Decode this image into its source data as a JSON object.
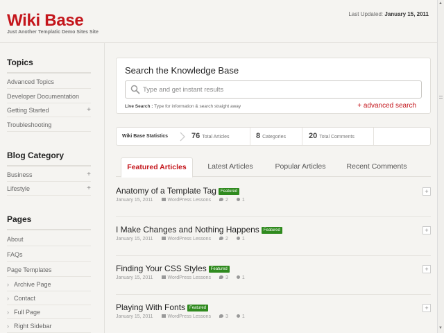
{
  "header": {
    "title": "Wiki Base",
    "tagline": "Just Another Templatic Demo Sites Site",
    "last_updated_label": "Last Updated:",
    "last_updated_date": "January 15, 2011"
  },
  "sidebar": {
    "sections": [
      {
        "heading": "Topics",
        "items": [
          {
            "label": "Advanced Topics",
            "expandable": false
          },
          {
            "label": "Developer Documentation",
            "expandable": false
          },
          {
            "label": "Getting Started",
            "expandable": true
          },
          {
            "label": "Troubleshooting",
            "expandable": false
          }
        ]
      },
      {
        "heading": "Blog Category",
        "items": [
          {
            "label": "Business",
            "expandable": true
          },
          {
            "label": "Lifestyle",
            "expandable": true
          }
        ]
      },
      {
        "heading": "Pages",
        "items": [
          {
            "label": "About"
          },
          {
            "label": "FAQs"
          },
          {
            "label": "Page Templates"
          },
          {
            "label": "Archive Page"
          },
          {
            "label": "Contact"
          },
          {
            "label": "Full Page"
          },
          {
            "label": "Right Sidebar"
          }
        ]
      }
    ],
    "plus_symbol": "+"
  },
  "search": {
    "title": "Search the Knowledge Base",
    "placeholder": "Type and get instant results",
    "value": "",
    "live_label": "Live Search :",
    "live_hint": "Type for information & search straight away",
    "advanced": "+ advanced search"
  },
  "stats": {
    "label": "Wiki Base Statistics",
    "items": [
      {
        "count": "76",
        "label": "Total Articles"
      },
      {
        "count": "8",
        "label": "Categories"
      },
      {
        "count": "20",
        "label": "Total Comments"
      }
    ]
  },
  "tabs": [
    {
      "label": "Featured Articles",
      "active": true
    },
    {
      "label": "Latest Articles",
      "active": false
    },
    {
      "label": "Popular Articles",
      "active": false
    },
    {
      "label": "Recent Comments",
      "active": false
    }
  ],
  "articles": [
    {
      "title": "Anatomy of a Template Tag",
      "badge": "Featured",
      "date": "January 15, 2011",
      "category": "WordPress Lessons",
      "comments": "2",
      "likes": "1"
    },
    {
      "title": "I Make Changes and Nothing Happens",
      "badge": "Featured",
      "date": "January 15, 2011",
      "category": "WordPress Lessons",
      "comments": "2",
      "likes": "1"
    },
    {
      "title": "Finding Your CSS Styles",
      "badge": "Featured",
      "date": "January 15, 2011",
      "category": "WordPress Lessons",
      "comments": "3",
      "likes": "1"
    },
    {
      "title": "Playing With Fonts",
      "badge": "Featured",
      "date": "January 15, 2011",
      "category": "WordPress Lessons",
      "comments": "3",
      "likes": "1"
    }
  ],
  "expand_symbol": "+",
  "colors": {
    "brand": "#c4161c",
    "badge": "#2f8a1e"
  }
}
